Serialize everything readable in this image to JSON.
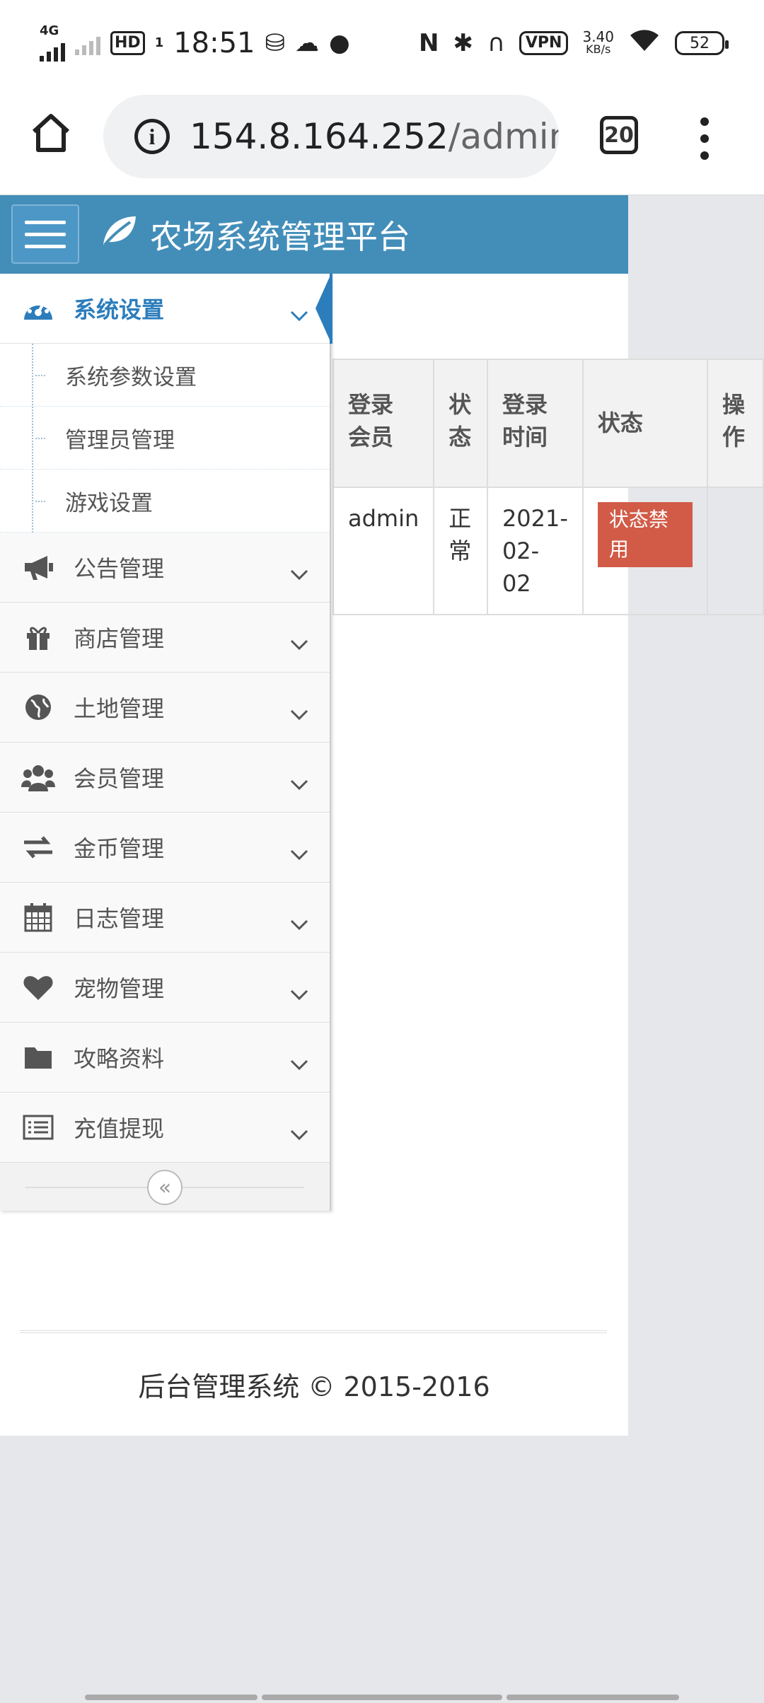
{
  "status_bar": {
    "network": "4G",
    "time": "18:51",
    "hd": "HD",
    "sim": "1",
    "vpn": "VPN",
    "speed_value": "3.40",
    "speed_unit": "KB/s",
    "battery": "52"
  },
  "browser": {
    "url_host": "154.8.164.252",
    "url_path": "/admin.",
    "tab_count": "20"
  },
  "app": {
    "title": "农场系统管理平台",
    "brand_color": "#438eb9"
  },
  "sidebar": {
    "active": {
      "label": "系统设置",
      "icon": "dashboard-icon"
    },
    "submenu": [
      {
        "label": "系统参数设置"
      },
      {
        "label": "管理员管理"
      },
      {
        "label": "游戏设置"
      }
    ],
    "items": [
      {
        "label": "公告管理",
        "icon": "bullhorn-icon"
      },
      {
        "label": "商店管理",
        "icon": "gift-icon"
      },
      {
        "label": "土地管理",
        "icon": "globe-icon"
      },
      {
        "label": "会员管理",
        "icon": "users-icon"
      },
      {
        "label": "金币管理",
        "icon": "exchange-icon"
      },
      {
        "label": "日志管理",
        "icon": "calendar-icon"
      },
      {
        "label": "宠物管理",
        "icon": "heart-icon"
      },
      {
        "label": "攻略资料",
        "icon": "folder-icon"
      },
      {
        "label": "充值提现",
        "icon": "list-icon"
      }
    ]
  },
  "table": {
    "headers": [
      "登录\n会员",
      "状\n态",
      "登录\n时间",
      "状态",
      "操\n作"
    ],
    "rows": [
      {
        "member": "admin",
        "status": "正\n常",
        "time": "2021-\n02-\n02",
        "label": "状态禁用",
        "action": ""
      }
    ]
  },
  "footer": {
    "text": "后台管理系统 © 2015-2016"
  }
}
